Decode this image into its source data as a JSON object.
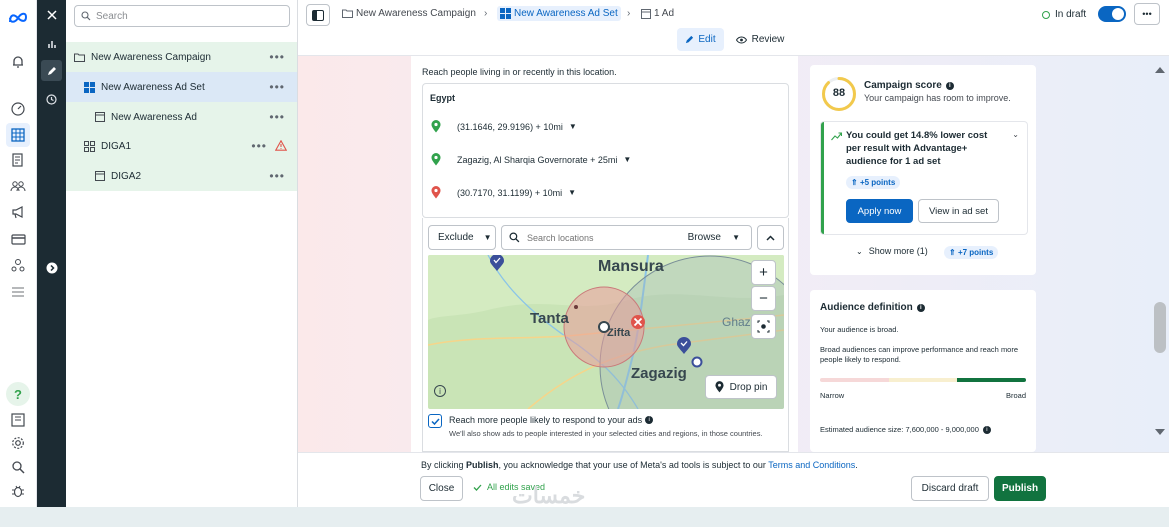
{
  "tree": {
    "search_placeholder": "Search",
    "items": [
      {
        "label": "New Awareness Campaign"
      },
      {
        "label": "New Awareness Ad Set"
      },
      {
        "label": "New Awareness Ad"
      },
      {
        "label": "DIGA1"
      },
      {
        "label": "DIGA2"
      }
    ]
  },
  "topbar": {
    "breadcrumb": [
      "New Awareness Campaign",
      "New Awareness Ad Set",
      "1 Ad"
    ],
    "status": "In draft",
    "tabs": {
      "edit": "Edit",
      "review": "Review"
    }
  },
  "location": {
    "intro": "Reach people living in or recently in this location.",
    "country": "Egypt",
    "entries": [
      {
        "text": "(31.1646, 29.9196) + 10mi",
        "pin_color": "#31a24c"
      },
      {
        "text": "Zagazig, Al Sharqia Governorate + 25mi",
        "pin_color": "#31a24c"
      },
      {
        "text": "(30.7170, 31.1199) + 10mi",
        "pin_color": "#e0544b"
      }
    ],
    "exclude_label": "Exclude",
    "search_placeholder": "Search locations",
    "browse_label": "Browse",
    "map": {
      "labels": {
        "mansura": "Mansura",
        "tanta": "Tanta",
        "zifta": "Zifta",
        "zagazig": "Zagazig",
        "ghaz": "Ghaz"
      },
      "drop_pin": "Drop pin",
      "zoom_in": "+",
      "zoom_out": "−",
      "info": "i"
    },
    "advantage_checkbox": {
      "checked": true,
      "label": "Reach more people likely to respond to your ads",
      "description": "We'll also show ads to people interested in your selected cities and regions, in those countries."
    }
  },
  "campaign_score": {
    "score": "88",
    "title": "Campaign score",
    "subtitle": "Your campaign has room to improve.",
    "recommendation": "You could get 14.8% lower cost per result with Advantage+ audience for 1 ad set",
    "rec_points": "+5 points",
    "apply_label": "Apply now",
    "view_label": "View in ad set",
    "show_more": "Show more (1)",
    "more_points": "+7 points",
    "score_color": "#f2c94c"
  },
  "audience": {
    "title": "Audience definition",
    "status": "Your audience is broad.",
    "explanation": "Broad audiences can improve performance and reach more people likely to respond.",
    "narrow_label": "Narrow",
    "broad_label": "Broad",
    "estimated_size": "Estimated audience size: 7,600,000 - 9,000,000"
  },
  "footer": {
    "notice_prefix": "By clicking ",
    "notice_bold": "Publish",
    "notice_mid": ", you acknowledge that your use of Meta's ad tools is subject to our ",
    "terms_link": "Terms and Conditions",
    "notice_suffix": ".",
    "close_label": "Close",
    "saved_status": "All edits saved",
    "discard_label": "Discard draft",
    "publish_label": "Publish"
  },
  "watermark": "خمسات"
}
